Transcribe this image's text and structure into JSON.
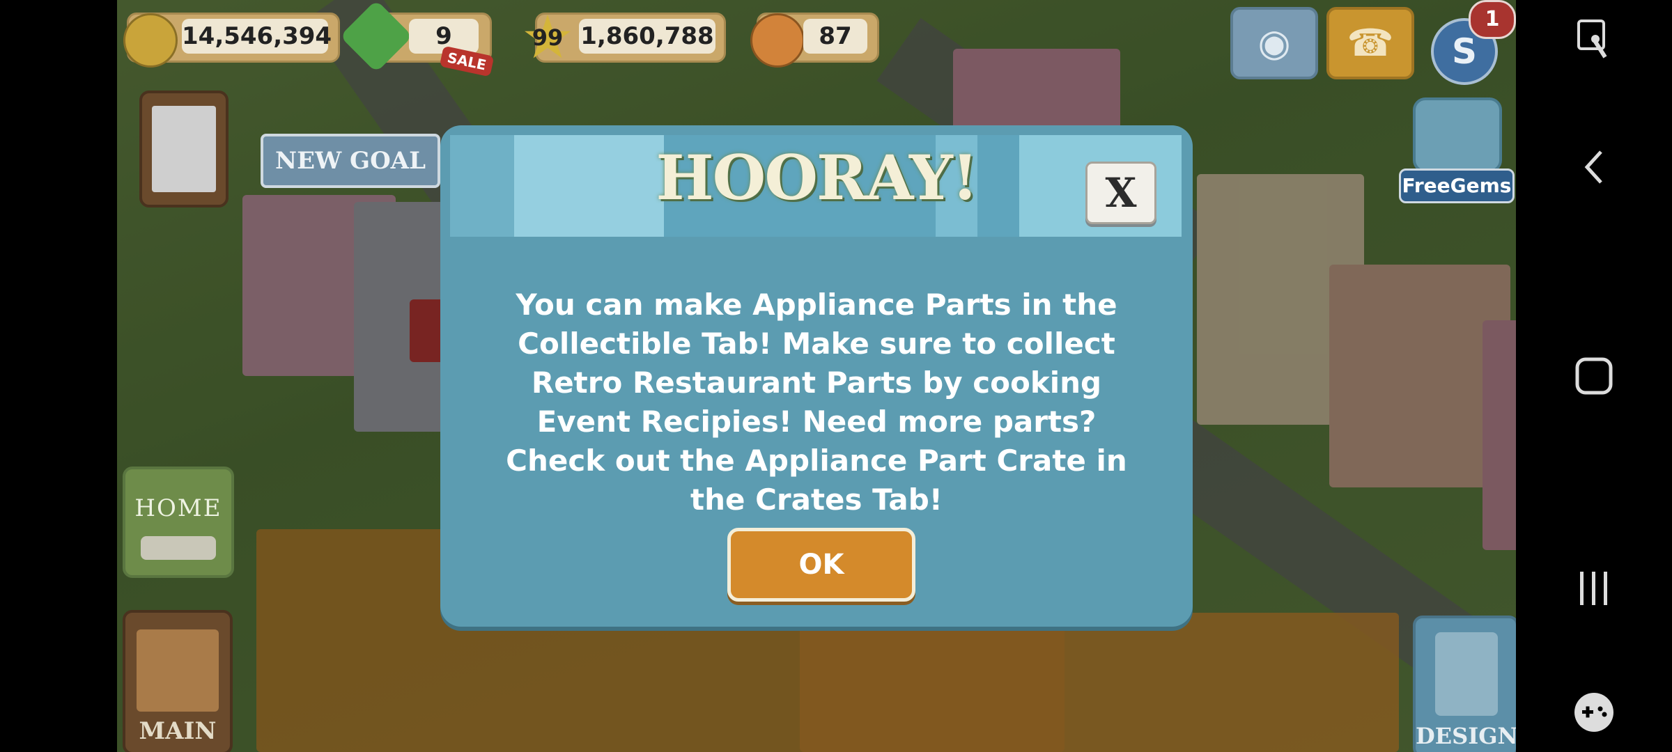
{
  "hud": {
    "coins": "14,546,394",
    "gems": "9",
    "gems_badge": "SALE",
    "level": "99",
    "xp": "1,860,788",
    "friends": "87",
    "notifications_count": "1"
  },
  "left_menu": {
    "new_goal_label": "NEW GOAL",
    "home_label": "HOME",
    "main_label": "MAIN"
  },
  "right_menu": {
    "free_gems_label": "FreeGems",
    "design_label": "DESIGN"
  },
  "modal": {
    "title": "HOORAY!",
    "close_label": "X",
    "message": "You can make Appliance Parts in the Collectible Tab! Make sure to collect Retro Restaurant Parts by cooking Event Recipies! Need more parts? Check out the Appliance Part Crate in the Crates Tab!",
    "ok_label": "OK"
  },
  "nav": {
    "icons": [
      "screen-lock-icon",
      "back-icon",
      "home-icon",
      "recents-icon",
      "game-tools-icon"
    ]
  }
}
